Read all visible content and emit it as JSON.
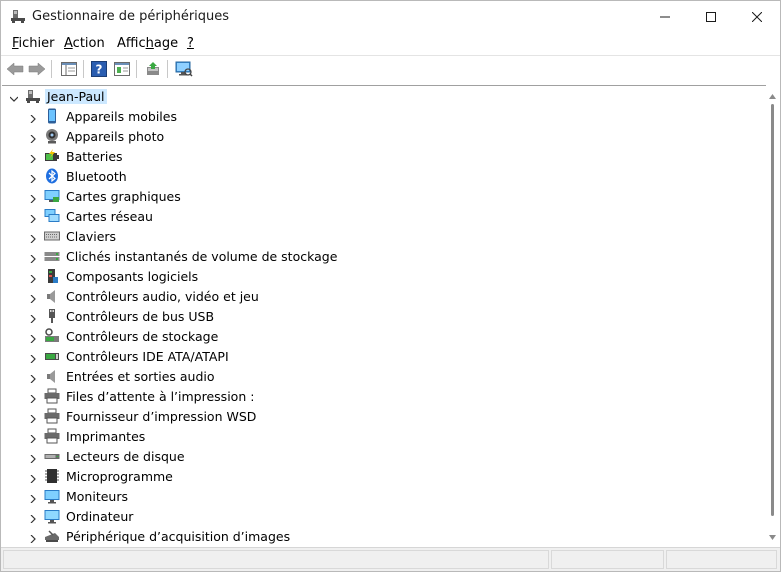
{
  "window": {
    "title": "Gestionnaire de périphériques"
  },
  "menu": {
    "items": [
      {
        "pre": "",
        "u": "F",
        "post": "ichier"
      },
      {
        "pre": "",
        "u": "A",
        "post": "ction"
      },
      {
        "pre": "Affic",
        "u": "h",
        "post": "age"
      },
      {
        "pre": "",
        "u": "?",
        "post": ""
      }
    ]
  },
  "toolbar": {
    "icons": [
      "back-arrow-icon",
      "forward-arrow-icon",
      "show-hide-console-tree-icon",
      "help-icon",
      "properties-icon",
      "update-driver-icon",
      "scan-hardware-icon"
    ]
  },
  "tree": {
    "root": "Jean-Paul",
    "categories": [
      {
        "label": "Appareils mobiles",
        "icon": "phone-icon"
      },
      {
        "label": "Appareils photo",
        "icon": "camera-icon"
      },
      {
        "label": "Batteries",
        "icon": "battery-icon"
      },
      {
        "label": "Bluetooth",
        "icon": "bluetooth-icon"
      },
      {
        "label": "Cartes graphiques",
        "icon": "display-adapter-icon"
      },
      {
        "label": "Cartes réseau",
        "icon": "network-adapter-icon"
      },
      {
        "label": "Claviers",
        "icon": "keyboard-icon"
      },
      {
        "label": "Clichés instantanés de volume de stockage",
        "icon": "storage-volume-icon"
      },
      {
        "label": "Composants logiciels",
        "icon": "software-component-icon"
      },
      {
        "label": "Contrôleurs audio, vidéo et jeu",
        "icon": "speaker-icon"
      },
      {
        "label": "Contrôleurs de bus USB",
        "icon": "usb-icon"
      },
      {
        "label": "Contrôleurs de stockage",
        "icon": "storage-controller-icon"
      },
      {
        "label": "Contrôleurs IDE ATA/ATAPI",
        "icon": "ide-controller-icon"
      },
      {
        "label": "Entrées et sorties audio",
        "icon": "speaker-icon"
      },
      {
        "label": "Files d’attente à l’impression :",
        "icon": "printer-icon"
      },
      {
        "label": "Fournisseur d’impression WSD",
        "icon": "printer-icon"
      },
      {
        "label": "Imprimantes",
        "icon": "printer-icon"
      },
      {
        "label": "Lecteurs de disque",
        "icon": "disk-drive-icon"
      },
      {
        "label": "Microprogramme",
        "icon": "firmware-chip-icon"
      },
      {
        "label": "Moniteurs",
        "icon": "monitor-icon"
      },
      {
        "label": "Ordinateur",
        "icon": "computer-icon"
      },
      {
        "label": "Périphérique d’acquisition d’images",
        "icon": "scanner-icon"
      }
    ]
  },
  "colors": {
    "selection": "#cce8ff",
    "accent": "#0078d7"
  }
}
